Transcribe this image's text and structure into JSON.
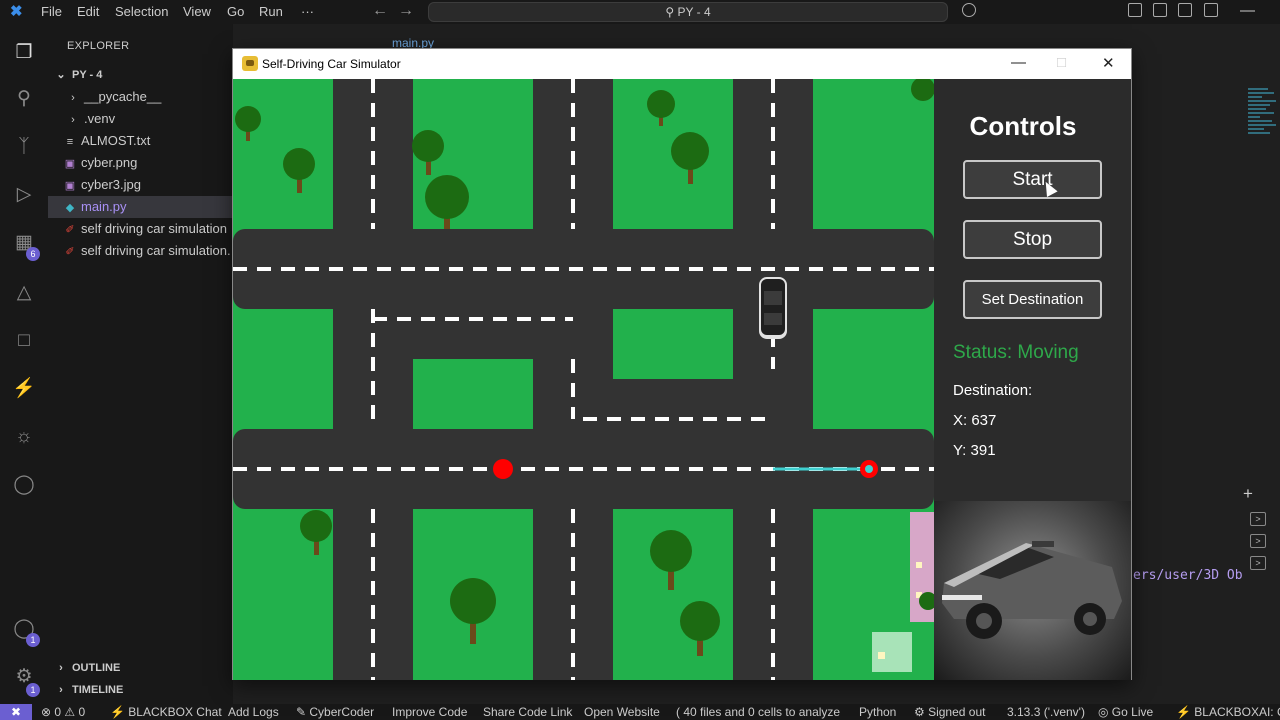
{
  "ide": {
    "menu": [
      "File",
      "Edit",
      "Selection",
      "View",
      "Go",
      "Run",
      "···"
    ],
    "search": "PY - 4",
    "explorer_header": "EXPLORER",
    "root_folder": "PY - 4",
    "files": [
      {
        "name": "__pycache__",
        "icon": "chevron-right-icon",
        "glyph": "›"
      },
      {
        "name": ".venv",
        "icon": "chevron-right-icon",
        "glyph": "›"
      },
      {
        "name": "ALMOST.txt",
        "icon": "text-file-icon",
        "glyph": "≡"
      },
      {
        "name": "cyber.png",
        "icon": "image-file-icon",
        "glyph": "▣"
      },
      {
        "name": "cyber3.jpg",
        "icon": "image-file-icon",
        "glyph": "▣"
      },
      {
        "name": "main.py",
        "icon": "python-file-icon",
        "glyph": "◆",
        "selected": true
      },
      {
        "name": "self driving car simulation",
        "icon": "pdf-file-icon",
        "glyph": "✐"
      },
      {
        "name": "self driving car simulation.",
        "icon": "pdf-file-icon",
        "glyph": "✐"
      }
    ],
    "outline": "OUTLINE",
    "timeline": "TIMELINE",
    "editor_tab": "main.py",
    "terminal_text": "ers/user/3D Ob",
    "status": [
      "⊗ 0 ⚠ 0",
      "⚡ BLACKBOX Chat",
      "Add Logs",
      "✎ CyberCoder",
      "Improve Code",
      "Share Code Link",
      "Open Website",
      "( 40 files and 0 cells to analyze",
      "Python",
      "⚙ Signed out",
      "3.13.3 ('.venv')",
      "◎ Go Live",
      "⚡ BLACKBOXAI: Op"
    ],
    "accent": "#6b5fd1"
  },
  "sim": {
    "window_title": "Self-Driving Car Simulator",
    "controls_title": "Controls",
    "start_label": "Start",
    "stop_label": "Stop",
    "set_destination_label": "Set Destination",
    "status": "Status: Moving",
    "destination_label": "Destination:",
    "dest_x": "X: 637",
    "dest_y": "Y: 391",
    "colors": {
      "grass": "#22b14c",
      "road": "#333333",
      "tree": "#1c6b12",
      "trunk": "#6b4a1a",
      "marker": "#ff0000",
      "path": "#3fd0d0",
      "status": "#2ea84a"
    }
  }
}
